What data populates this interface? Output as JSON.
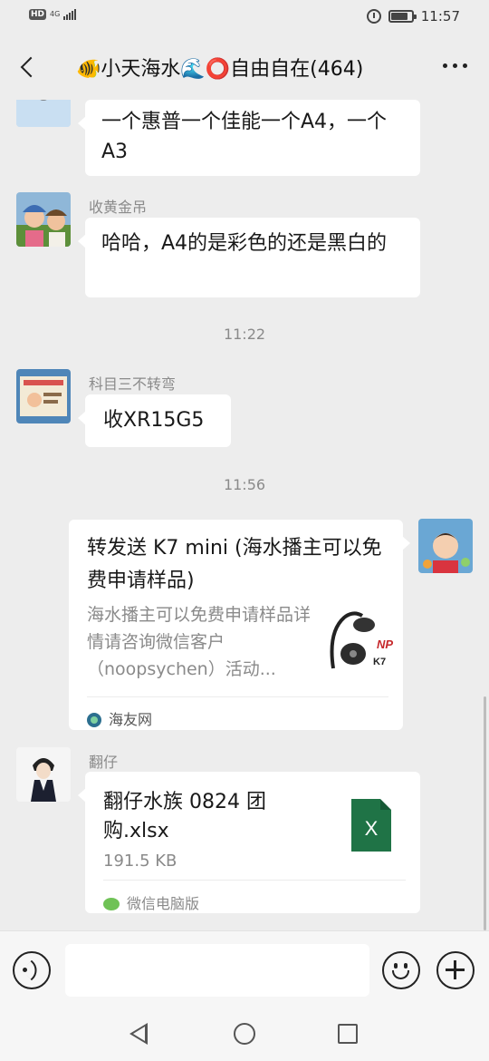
{
  "status_bar": {
    "hd_label": "HD",
    "network_label": "4G",
    "time": "11:57",
    "battery_level": 0.85
  },
  "header": {
    "title": "🐠小天海水🌊⭕自由自在(464)"
  },
  "messages": [
    {
      "sender": "",
      "text": "一个惠普一个佳能一个A4，一个A3"
    },
    {
      "sender": "收黄金吊",
      "text": "哈哈，A4的是彩色的还是黑白的"
    },
    {
      "time": "11:22"
    },
    {
      "sender": "科目三不转弯",
      "text": "收XR15G5"
    },
    {
      "time": "11:56"
    },
    {
      "sender": "",
      "card_title": "转发送 K7 mini (海水播主可以免费申请样品)",
      "card_desc": "海水播主可以免费申请样品详情请咨询微信客户（noopsychen）活动...",
      "card_source": "海友网",
      "thumb_caption": "K7"
    },
    {
      "sender": "翻仔",
      "file_name": "翻仔水族 0824 团购.xlsx",
      "file_size": "191.5 KB",
      "file_icon_letter": "X",
      "file_source": "微信电脑版"
    }
  ],
  "colors": {
    "background": "#ededed",
    "bubble": "#ffffff",
    "excel_green": "#1f7346",
    "wechat_green": "#6fc256"
  },
  "icons": {
    "back": "back-chevron-icon",
    "more": "more-dots-icon",
    "voice": "voice-icon",
    "emoji": "emoji-icon",
    "plus": "plus-icon"
  }
}
